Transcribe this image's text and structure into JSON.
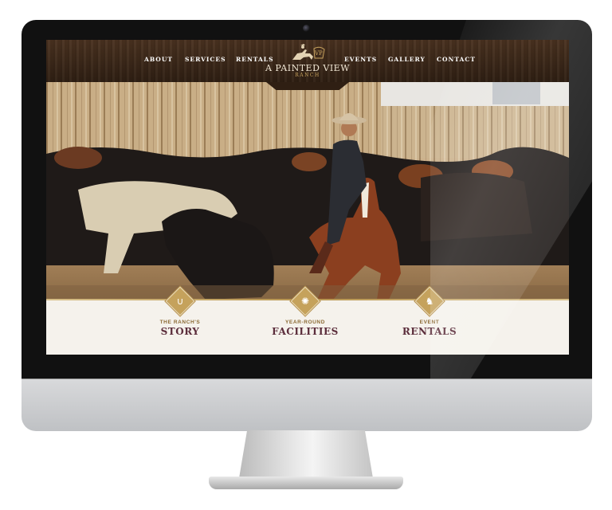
{
  "nav": {
    "items": [
      {
        "label": "ABOUT"
      },
      {
        "label": "SERVICES"
      },
      {
        "label": "RENTALS"
      },
      {
        "label": "EVENTS"
      },
      {
        "label": "GALLERY"
      },
      {
        "label": "CONTACT"
      }
    ]
  },
  "logo": {
    "monogram": "VP",
    "title": "A PAINTED VIEW",
    "subtitle": "RANCH"
  },
  "features": [
    {
      "kicker": "THE RANCH'S",
      "title": "STORY",
      "icon": "horseshoe-icon"
    },
    {
      "kicker": "YEAR-ROUND",
      "title": "FACILITIES",
      "icon": "wagon-wheel-icon"
    },
    {
      "kicker": "EVENT",
      "title": "RENTALS",
      "icon": "horse-head-icon"
    }
  ],
  "colors": {
    "header_wood": "#3d2818",
    "accent_gold": "#c5a25c",
    "title_maroon": "#5b2d3b",
    "page_background": "#f5f2ec"
  }
}
